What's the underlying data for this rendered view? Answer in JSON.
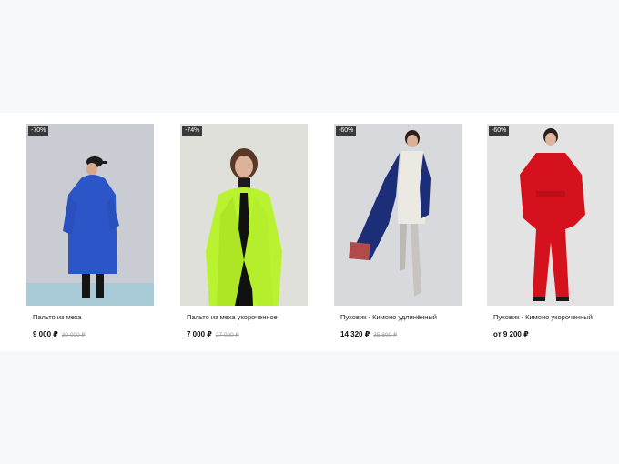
{
  "products": [
    {
      "badge": "-70%",
      "name": "Пальто из меха",
      "price": "9 000 ₽",
      "old_price": "30 000 ₽",
      "color": "#2c55c8"
    },
    {
      "badge": "-74%",
      "name": "Пальто из меха укороченное",
      "price": "7 000 ₽",
      "old_price": "27 000 ₽",
      "color": "#b8f230"
    },
    {
      "badge": "-60%",
      "name": "Пуховик - Кимоно удлинённый",
      "price": "14 320 ₽",
      "old_price": "35 800 ₽",
      "color": "#1c2e78"
    },
    {
      "badge": "-60%",
      "name": "Пуховик - Кимоно укороченный",
      "price": "от  9 200 ₽",
      "old_price": "",
      "color": "#d4111c"
    }
  ]
}
